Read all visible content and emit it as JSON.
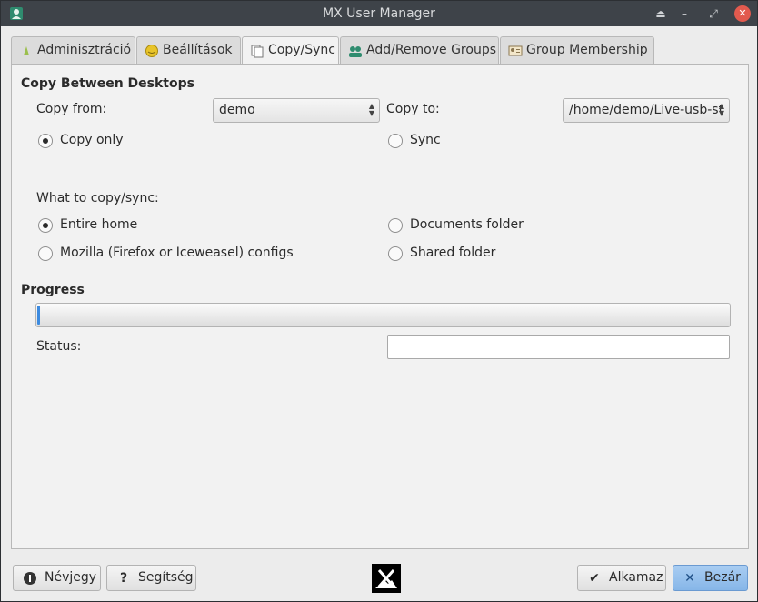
{
  "window": {
    "title": "MX User Manager"
  },
  "tabs": [
    {
      "label": "Adminisztráció",
      "icon": "admin-icon"
    },
    {
      "label": "Beállítások",
      "icon": "settings-icon"
    },
    {
      "label": "Copy/Sync",
      "icon": "copy-icon"
    },
    {
      "label": "Add/Remove Groups",
      "icon": "groups-icon"
    },
    {
      "label": "Group Membership",
      "icon": "membership-icon"
    }
  ],
  "copy_between": {
    "title": "Copy Between Desktops",
    "copy_from_label": "Copy from:",
    "copy_from_value": "demo",
    "copy_to_label": "Copy to:",
    "copy_to_value": "/home/demo/Live-usb-st",
    "mode": {
      "copy_only": "Copy only",
      "sync": "Sync",
      "selected": "copy_only"
    },
    "what_label": "What to copy/sync:",
    "options": {
      "entire_home": "Entire home",
      "documents": "Documents folder",
      "mozilla": "Mozilla (Firefox or Iceweasel) configs",
      "shared": "Shared folder",
      "selected": "entire_home"
    }
  },
  "progress": {
    "title": "Progress",
    "value_percent": 0,
    "status_label": "Status:",
    "status_value": ""
  },
  "buttons": {
    "about": "Névjegy",
    "help": "Segítség",
    "apply": "Alkamaz",
    "close": "Bezár"
  },
  "colors": {
    "accent": "#3d8be0",
    "titlebar": "#3e4349",
    "close": "#e25a4e"
  }
}
